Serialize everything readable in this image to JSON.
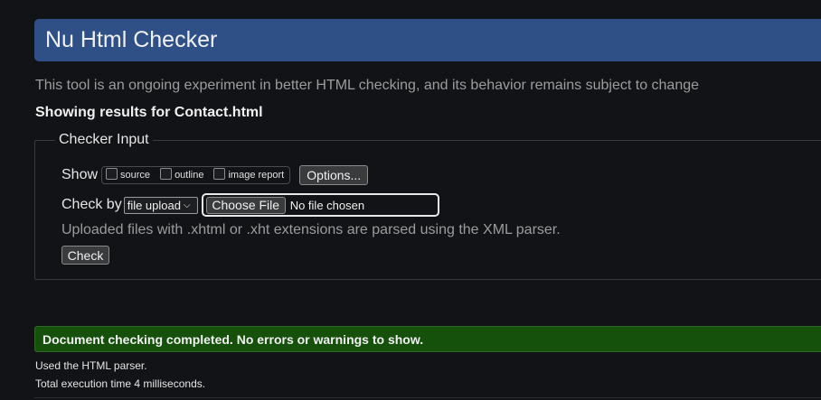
{
  "header": {
    "title": "Nu Html Checker"
  },
  "intro": "This tool is an ongoing experiment in better HTML checking, and its behavior remains subject to change",
  "results_for": "Showing results for Contact.html",
  "checker_input": {
    "legend": "Checker Input",
    "show_label": "Show",
    "show_options": [
      {
        "label": "source",
        "checked": false
      },
      {
        "label": "outline",
        "checked": false
      },
      {
        "label": "image report",
        "checked": false
      }
    ],
    "options_button": "Options...",
    "check_by_label": "Check by",
    "check_by_selected": "file upload",
    "choose_file_button": "Choose File",
    "file_status": "No file chosen",
    "xml_note": "Uploaded files with .xhtml or .xht extensions are parsed using the XML parser.",
    "check_button": "Check"
  },
  "result": {
    "message": "Document checking completed. No errors or warnings to show.",
    "details": [
      "Used the HTML parser.",
      "Total execution time 4 milliseconds."
    ]
  },
  "colors": {
    "background": "#121316",
    "header": "#2f5086",
    "success": "#16510c",
    "muted_text": "#9c9c9c"
  }
}
